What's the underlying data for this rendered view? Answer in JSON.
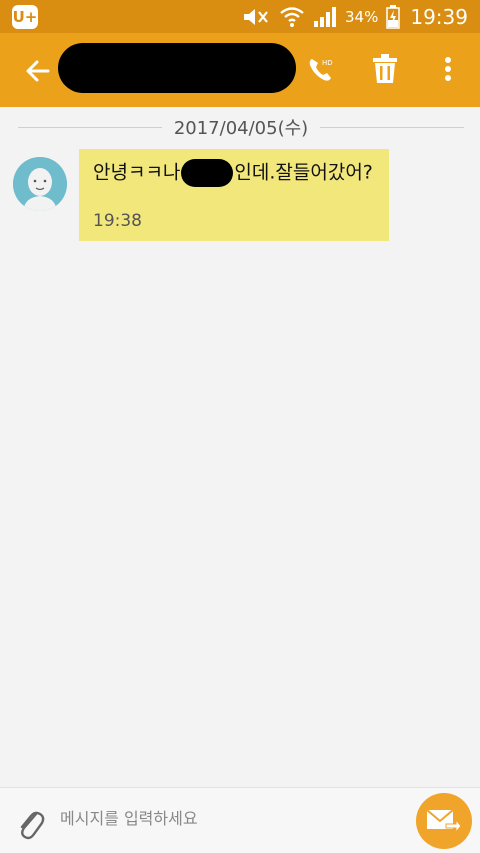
{
  "status_bar": {
    "carrier_logo": "U+",
    "icons": [
      "mute-icon",
      "wifi-icon",
      "signal-icon",
      "battery-charging-icon"
    ],
    "battery": "34%",
    "time": "19:39"
  },
  "app_bar": {
    "contact_name": "[redacted]",
    "accent_color": "#eba21a",
    "actions": [
      "back-arrow-icon",
      "phone-call-icon",
      "trash-icon",
      "more-vert-icon"
    ]
  },
  "conversation": {
    "date_divider": "2017/04/05(수)",
    "messages": [
      {
        "text_before": "안녕ㅋㅋ나",
        "redacted": "[redacted]",
        "text_after": "인데.잘들어갔어?",
        "time": "19:38",
        "bubble_color": "#f2e77b"
      }
    ]
  },
  "composer": {
    "placeholder": "메시지를 입력하세요",
    "value": ""
  }
}
